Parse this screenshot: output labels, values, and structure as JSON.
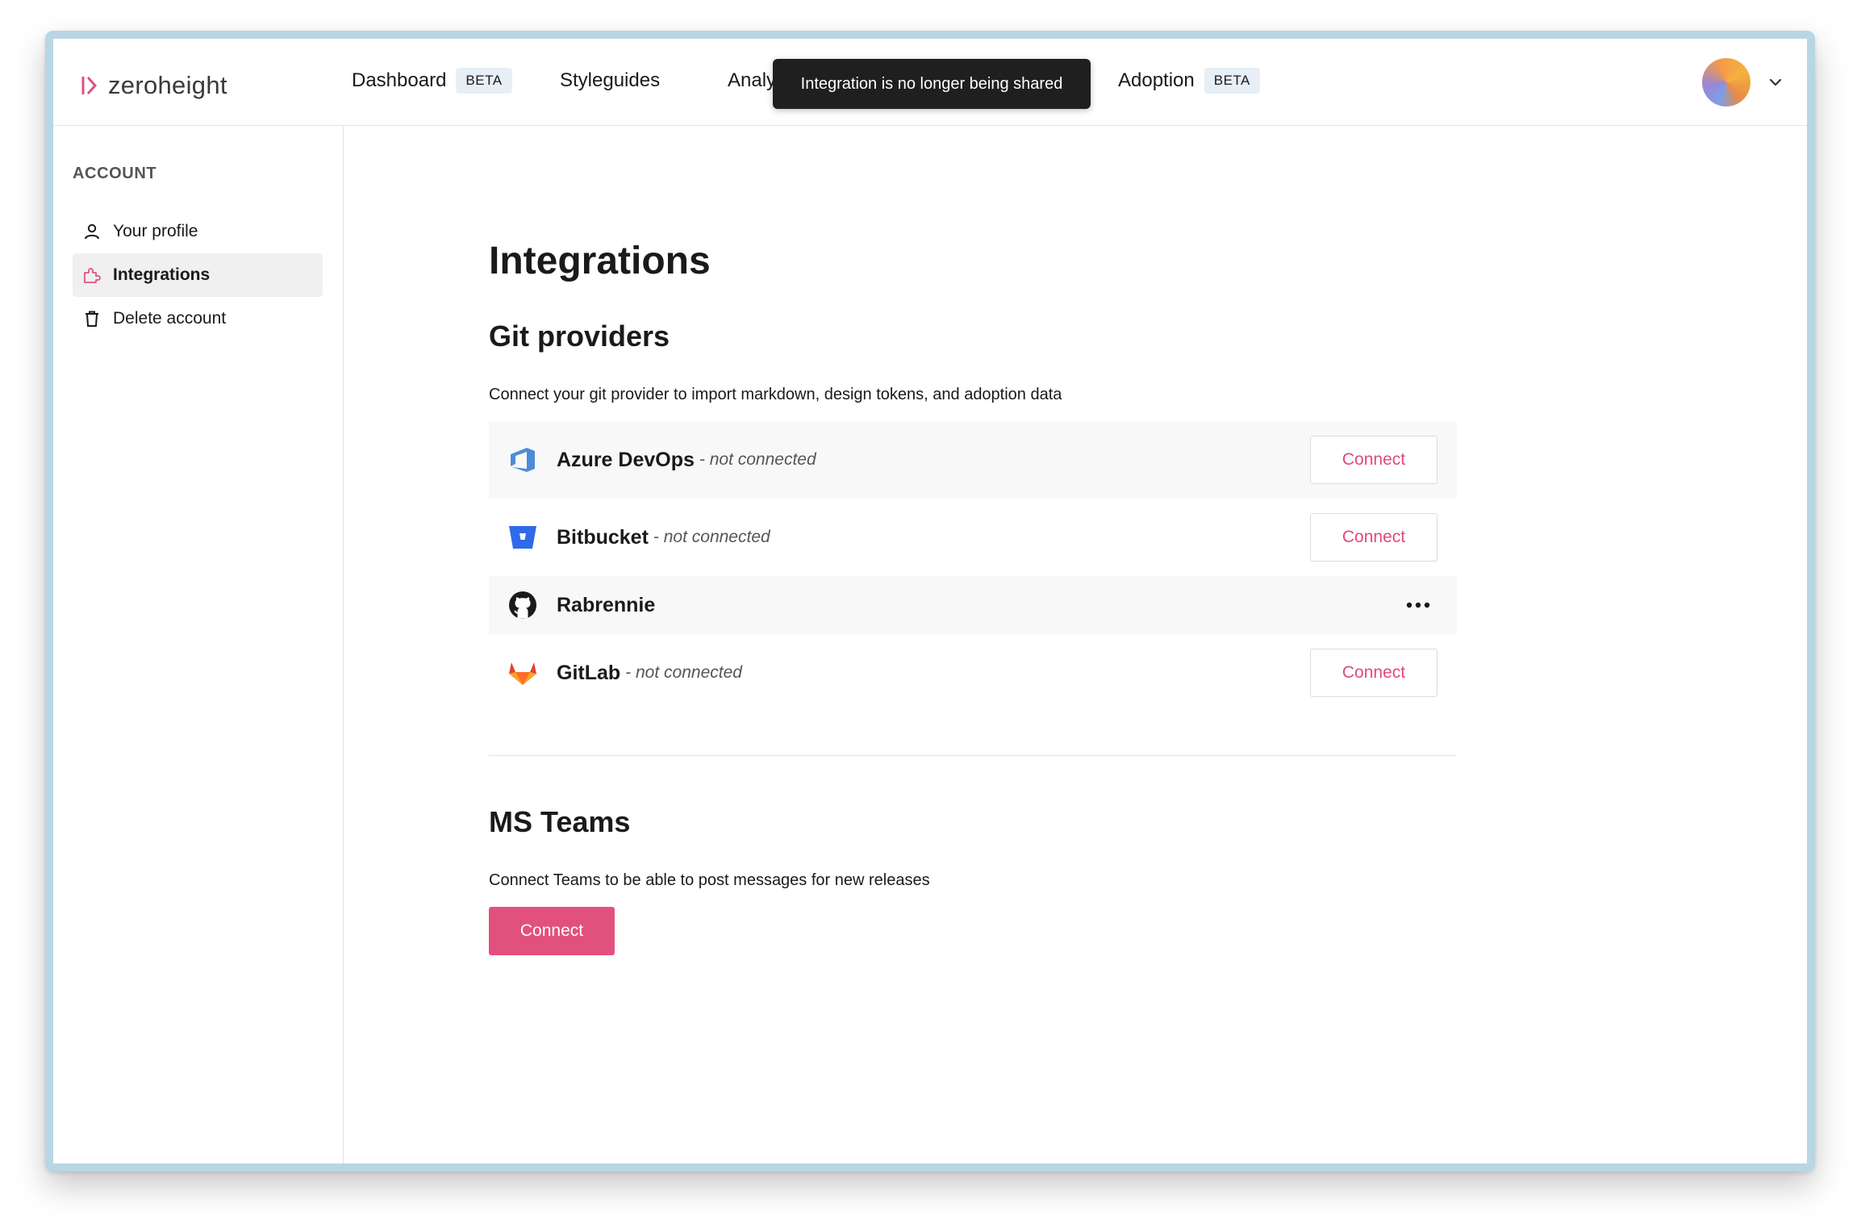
{
  "brand": {
    "name": "zeroheight",
    "accent": "#e2507e"
  },
  "nav": {
    "items": [
      {
        "label": "Dashboard",
        "badge": "BETA"
      },
      {
        "label": "Styleguides",
        "badge": ""
      },
      {
        "label": "Analyt",
        "badge": ""
      },
      {
        "label": "Adoption",
        "badge": "BETA"
      }
    ]
  },
  "toast": {
    "message": "Integration is no longer being shared"
  },
  "user": {
    "avatar_icon": "avatar",
    "menu_icon": "chevron-down-icon"
  },
  "sidebar": {
    "heading": "ACCOUNT",
    "items": [
      {
        "label": "Your profile",
        "icon": "user-icon",
        "active": false
      },
      {
        "label": "Integrations",
        "icon": "puzzle-icon",
        "active": true
      },
      {
        "label": "Delete account",
        "icon": "trash-icon",
        "active": false
      }
    ]
  },
  "main": {
    "title": "Integrations",
    "git": {
      "title": "Git providers",
      "description": "Connect your git provider to import markdown, design tokens, and adoption data",
      "providers": [
        {
          "name": "Azure DevOps",
          "status": "- not connected",
          "action": "Connect",
          "icon": "azure-devops-icon"
        },
        {
          "name": "Bitbucket",
          "status": "- not connected",
          "action": "Connect",
          "icon": "bitbucket-icon"
        },
        {
          "name": "Rabrennie",
          "status": "",
          "action": "",
          "icon": "github-icon"
        },
        {
          "name": "GitLab",
          "status": "- not connected",
          "action": "Connect",
          "icon": "gitlab-icon"
        }
      ]
    },
    "teams": {
      "title": "MS Teams",
      "description": "Connect Teams to be able to post messages for new releases",
      "action": "Connect"
    }
  }
}
